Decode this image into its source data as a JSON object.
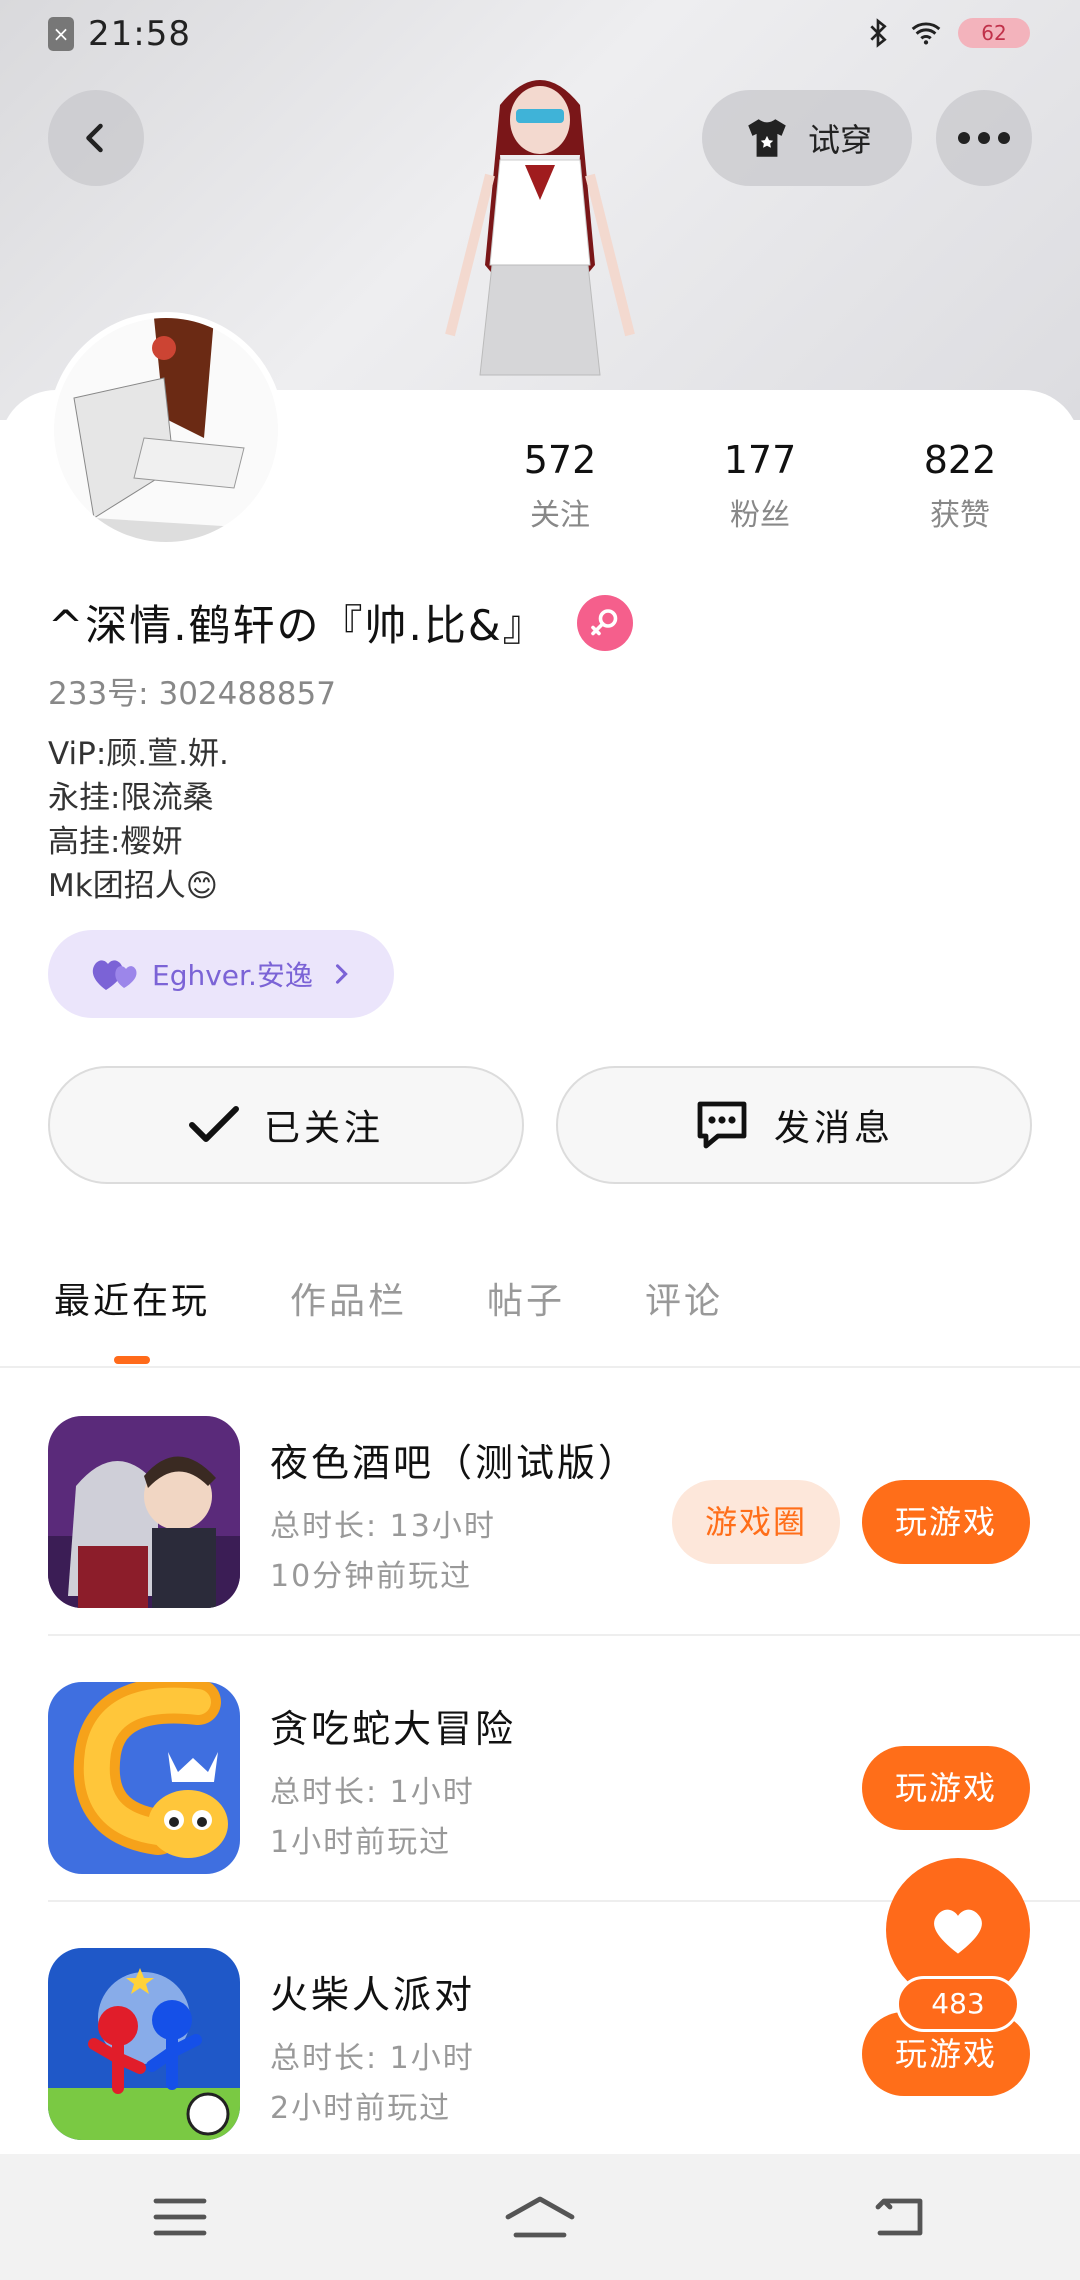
{
  "status_bar": {
    "time": "21:58",
    "battery": "62"
  },
  "header": {
    "try_on_label": "试穿"
  },
  "profile": {
    "stats": [
      {
        "value": "572",
        "label": "关注"
      },
      {
        "value": "177",
        "label": "粉丝"
      },
      {
        "value": "822",
        "label": "获赞"
      }
    ],
    "username": "^深情.鹤轩の『帅.比&』",
    "uid": "233号: 302488857",
    "bio": [
      "ViP:顾.萱.妍.",
      "永挂:限流桑",
      "高挂:樱妍",
      "Mk团招人😊"
    ],
    "pair_name": "Eghver.安逸"
  },
  "actions": {
    "follow_label": "已关注",
    "message_label": "发消息"
  },
  "tabs": [
    {
      "label": "最近在玩"
    },
    {
      "label": "作品栏"
    },
    {
      "label": "帖子"
    },
    {
      "label": "评论"
    }
  ],
  "games": [
    {
      "title": "夜色酒吧（测试版）",
      "total_time": "总时长: 13小时",
      "last_played": "10分钟前玩过",
      "circle_label": "游戏圈",
      "play_label": "玩游戏"
    },
    {
      "title": "贪吃蛇大冒险",
      "total_time": "总时长: 1小时",
      "last_played": "1小时前玩过",
      "play_label": "玩游戏"
    },
    {
      "title": "火柴人派对",
      "total_time": "总时长: 1小时",
      "last_played": "2小时前玩过",
      "play_label": "玩游戏"
    }
  ],
  "fab": {
    "count": "483"
  },
  "colors": {
    "accent": "#ff6e19",
    "pair_chip_bg": "#ebe5fb",
    "pair_text": "#7b63d6",
    "gender_badge": "#f55f8c"
  }
}
